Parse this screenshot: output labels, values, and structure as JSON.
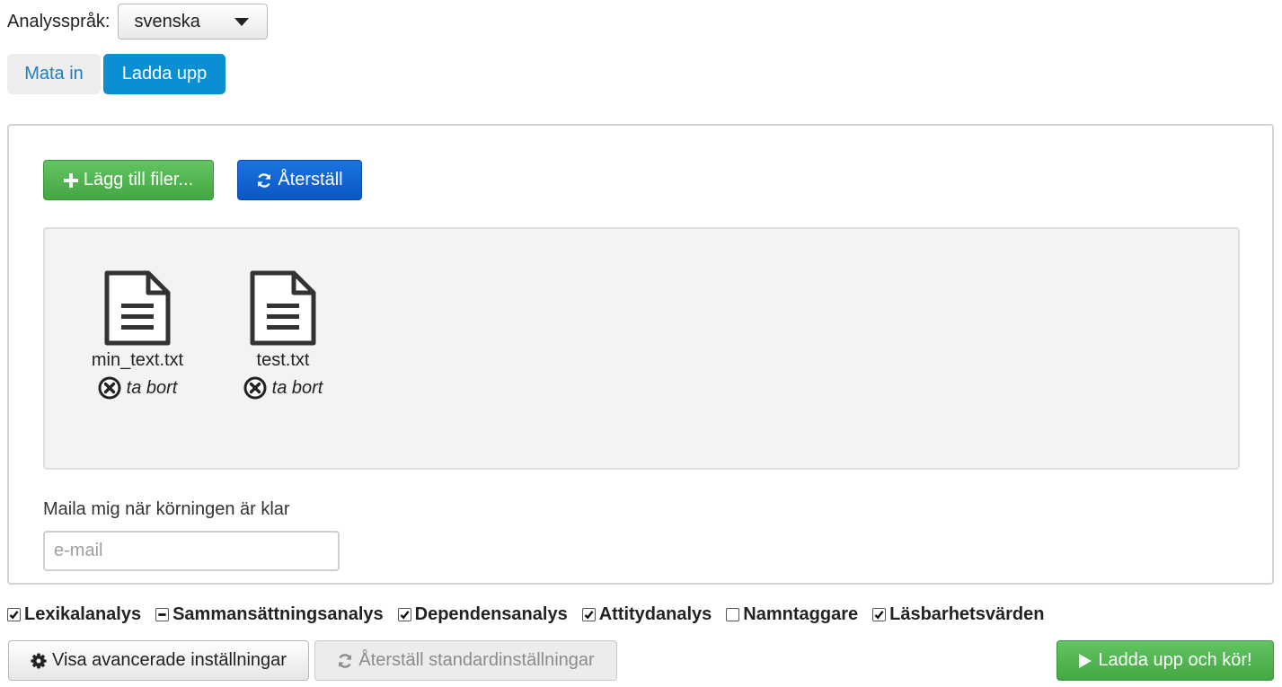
{
  "language": {
    "label": "Analysspråk:",
    "selected": "svenska"
  },
  "tabs": [
    {
      "label": "Mata in",
      "active": false
    },
    {
      "label": "Ladda upp",
      "active": true
    }
  ],
  "upload": {
    "add_files_label": "Lägg till filer...",
    "reset_label": "Återställ",
    "files": [
      {
        "name": "min_text.txt",
        "remove_label": "ta bort"
      },
      {
        "name": "test.txt",
        "remove_label": "ta bort"
      }
    ]
  },
  "mail": {
    "label": "Maila mig när körningen är klar",
    "placeholder": "e-mail",
    "value": ""
  },
  "analyses": [
    {
      "label": "Lexikalanalys",
      "state": "checked"
    },
    {
      "label": "Sammansättningsanalys",
      "state": "indeterminate"
    },
    {
      "label": "Dependensanalys",
      "state": "checked"
    },
    {
      "label": "Attitydanalys",
      "state": "checked"
    },
    {
      "label": "Namntaggare",
      "state": "unchecked"
    },
    {
      "label": "Läsbarhetsvärden",
      "state": "checked"
    }
  ],
  "footer": {
    "advanced_label": "Visa avancerade inställningar",
    "defaults_label": "Återställ standardinställningar",
    "run_label": "Ladda upp och kör!"
  },
  "colors": {
    "tab_active": "#0a8ed4",
    "success": "#4cae4c",
    "primary": "#0b56c4",
    "link": "#1b7fc0"
  },
  "icons": {
    "add": "plus-icon",
    "reset": "refresh-icon",
    "file": "file-text-icon",
    "remove": "remove-circle-icon",
    "advanced": "gear-icon",
    "run": "play-icon",
    "select": "chevron-down-icon"
  }
}
